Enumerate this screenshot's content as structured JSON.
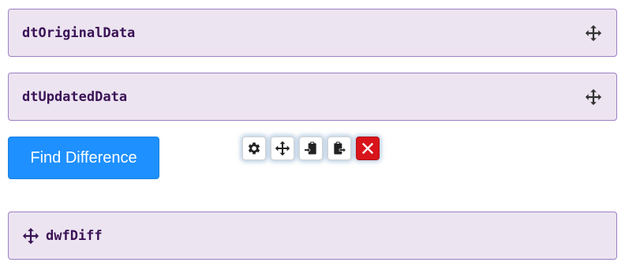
{
  "panels": {
    "original": {
      "label": "dtOriginalData",
      "icon": "move-icon"
    },
    "updated": {
      "label": "dtUpdatedData",
      "icon": "move-icon"
    },
    "diff": {
      "label": "dwfDiff",
      "icon": "move-icon"
    }
  },
  "find_button": {
    "label": "Find Difference"
  },
  "toolbar": {
    "buttons": [
      {
        "icon": "gear-icon"
      },
      {
        "icon": "move-icon"
      },
      {
        "icon": "paste-in-icon"
      },
      {
        "icon": "paste-out-icon"
      },
      {
        "icon": "close-icon"
      }
    ]
  },
  "colors": {
    "panel_bg": "#ece4f0",
    "panel_border": "#9b7fc4",
    "label_text": "#3a1357",
    "button_bg": "#1e90ff",
    "delete_bg": "#d9141b"
  }
}
